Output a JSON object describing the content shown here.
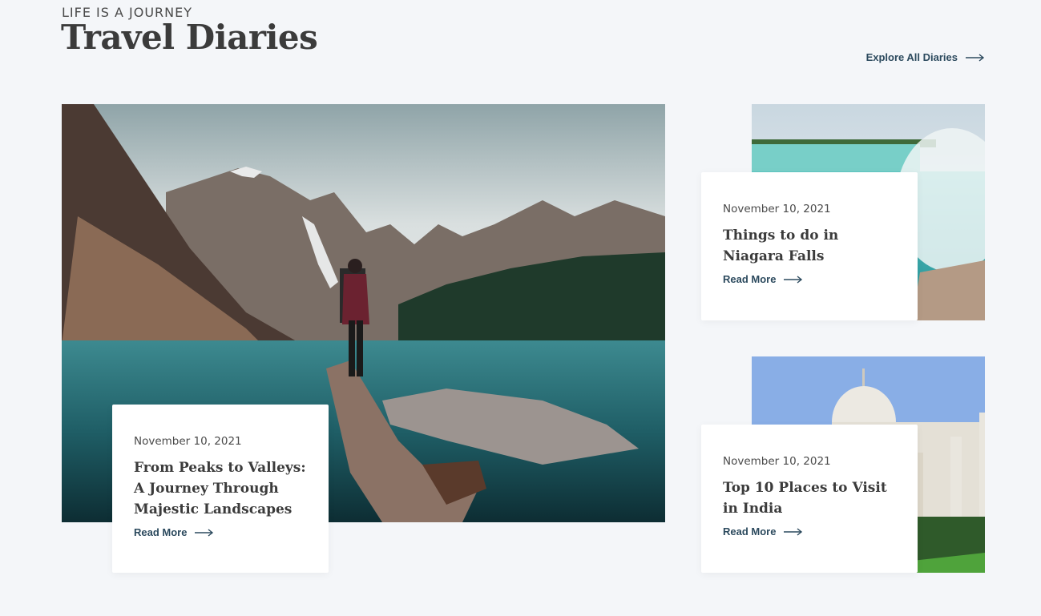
{
  "header": {
    "eyebrow": "LIFE IS A JOURNEY",
    "title": "Travel Diaries",
    "explore_label": "Explore All Diaries"
  },
  "posts": [
    {
      "date": "November 10, 2021",
      "title": "From Peaks to Valleys: A Journey Through Majestic Landscapes",
      "read_more": "Read More"
    },
    {
      "date": "November 10, 2021",
      "title": "Things to do in Niagara Falls",
      "read_more": "Read More"
    },
    {
      "date": "November 10, 2021",
      "title": "Top 10 Places to Visit in India",
      "read_more": "Read More"
    }
  ],
  "colors": {
    "background": "#f4f6f9",
    "link": "#2c4a5e",
    "heading": "#3b3b3b"
  }
}
